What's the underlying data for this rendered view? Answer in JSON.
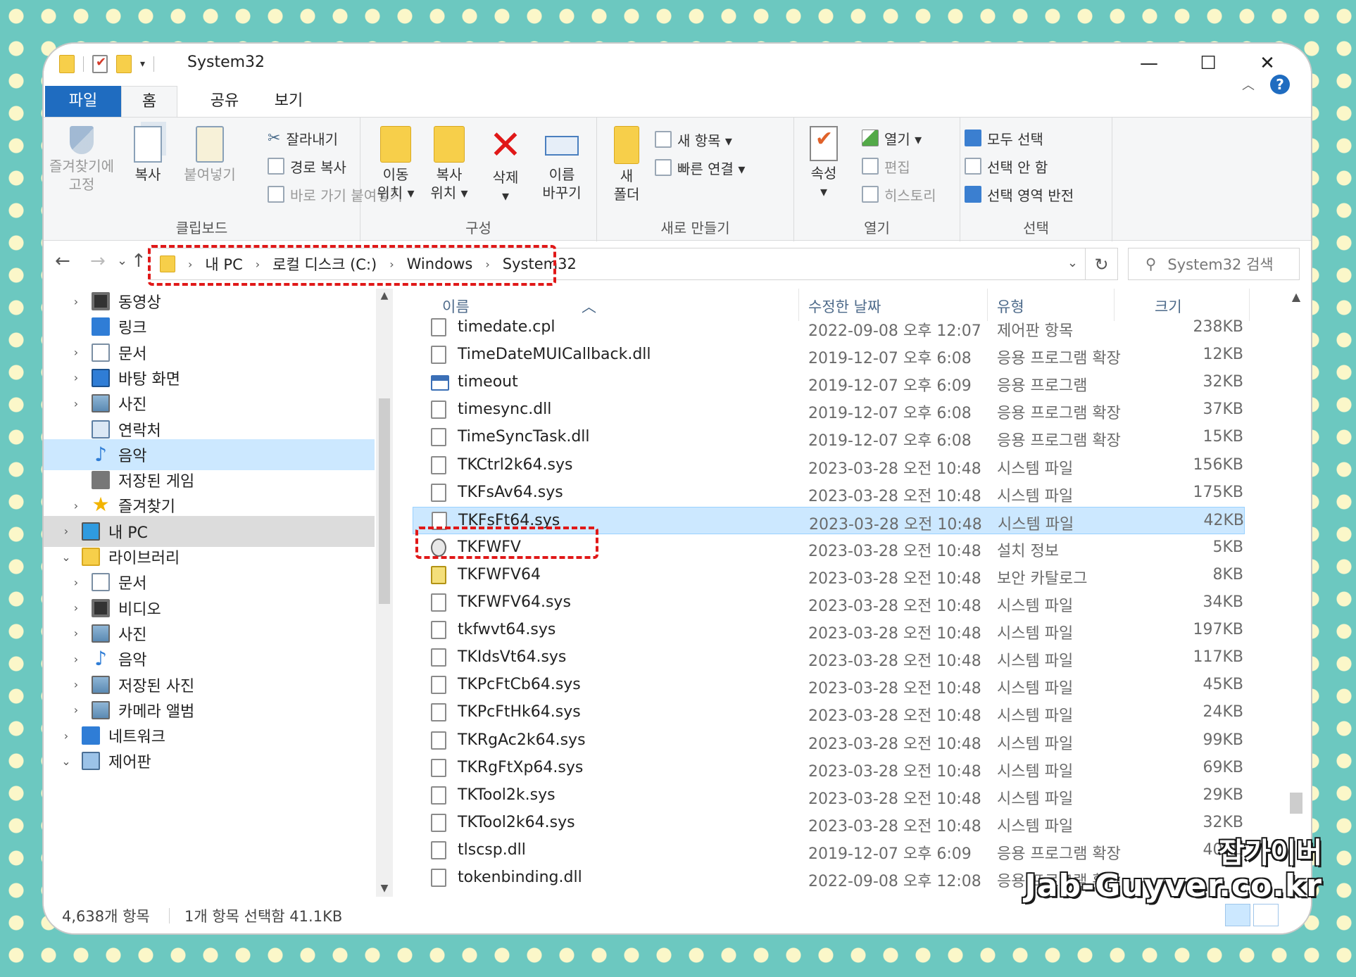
{
  "window": {
    "title": "System32",
    "controls": {
      "minimize": "—",
      "maximize": "☐",
      "close": "✕"
    }
  },
  "ribbon_tabs": [
    "파일",
    "홈",
    "공유",
    "보기"
  ],
  "ribbon": {
    "clipboard": {
      "label": "클립보드",
      "pin_l1": "즐겨찾기에",
      "pin_l2": "고정",
      "copy": "복사",
      "paste": "붙여넣기",
      "cut": "잘라내기",
      "copy_path": "경로 복사",
      "paste_shortcut": "바로 가기 붙여넣기"
    },
    "organize": {
      "label": "구성",
      "move_l1": "이동",
      "move_l2": "위치 ▾",
      "copyto_l1": "복사",
      "copyto_l2": "위치 ▾",
      "delete": "삭제",
      "delete_drop": "▾",
      "rename_l1": "이름",
      "rename_l2": "바꾸기"
    },
    "new": {
      "label": "새로 만들기",
      "new_folder_l1": "새",
      "new_folder_l2": "폴더",
      "new_item": "새 항목 ▾",
      "easy_access": "빠른 연결 ▾"
    },
    "open": {
      "label": "열기",
      "properties": "속성",
      "properties_drop": "▾",
      "open": "열기 ▾",
      "edit": "편집",
      "history": "히스토리"
    },
    "select": {
      "label": "선택",
      "select_all": "모두 선택",
      "select_none": "선택 안 함",
      "invert": "선택 영역 반전"
    }
  },
  "nav": {
    "back": "←",
    "forward": "→",
    "recent": "⌄",
    "up": "↑",
    "breadcrumb": [
      "내 PC",
      "로컬 디스크 (C:)",
      "Windows",
      "System32"
    ],
    "refresh": "↻",
    "search_placeholder": "System32 검색"
  },
  "tree": [
    {
      "label": "동영상",
      "icon": "video-icon",
      "chev": "›"
    },
    {
      "label": "링크",
      "icon": "link-icon",
      "chev": ""
    },
    {
      "label": "문서",
      "icon": "document-icon",
      "chev": "›"
    },
    {
      "label": "바탕 화면",
      "icon": "desktop-icon",
      "chev": "›"
    },
    {
      "label": "사진",
      "icon": "picture-icon",
      "chev": "›"
    },
    {
      "label": "연락처",
      "icon": "contact-icon",
      "chev": ""
    },
    {
      "label": "음악",
      "icon": "music-icon",
      "chev": ""
    },
    {
      "label": "저장된 게임",
      "icon": "game-icon",
      "chev": ""
    },
    {
      "label": "즐겨찾기",
      "icon": "star-icon",
      "chev": "›"
    },
    {
      "label": "내 PC",
      "icon": "pc-icon",
      "chev": "›"
    },
    {
      "label": "라이브러리",
      "icon": "library-icon",
      "chev": "⌄"
    },
    {
      "label": "문서",
      "icon": "document-icon",
      "chev": "›"
    },
    {
      "label": "비디오",
      "icon": "video-icon",
      "chev": "›"
    },
    {
      "label": "사진",
      "icon": "picture-icon",
      "chev": "›"
    },
    {
      "label": "음악",
      "icon": "music-icon",
      "chev": "›"
    },
    {
      "label": "저장된 사진",
      "icon": "picture-icon",
      "chev": "›"
    },
    {
      "label": "카메라 앨범",
      "icon": "picture-icon",
      "chev": "›"
    },
    {
      "label": "네트워크",
      "icon": "network-icon",
      "chev": "›"
    },
    {
      "label": "제어판",
      "icon": "control-panel-icon",
      "chev": "⌄"
    }
  ],
  "columns": {
    "name": "이름",
    "date": "수정한 날짜",
    "type": "유형",
    "size": "크기"
  },
  "files": [
    {
      "name": "timedate.cpl",
      "date": "2022-09-08 오후 12:07",
      "type": "제어판 항목",
      "size": "238KB"
    },
    {
      "name": "TimeDateMUICallback.dll",
      "date": "2019-12-07 오후 6:08",
      "type": "응용 프로그램 확장",
      "size": "12KB"
    },
    {
      "name": "timeout",
      "date": "2019-12-07 오후 6:09",
      "type": "응용 프로그램",
      "size": "32KB"
    },
    {
      "name": "timesync.dll",
      "date": "2019-12-07 오후 6:08",
      "type": "응용 프로그램 확장",
      "size": "37KB"
    },
    {
      "name": "TimeSyncTask.dll",
      "date": "2019-12-07 오후 6:08",
      "type": "응용 프로그램 확장",
      "size": "15KB"
    },
    {
      "name": "TKCtrl2k64.sys",
      "date": "2023-03-28 오전 10:48",
      "type": "시스템 파일",
      "size": "156KB"
    },
    {
      "name": "TKFsAv64.sys",
      "date": "2023-03-28 오전 10:48",
      "type": "시스템 파일",
      "size": "175KB"
    },
    {
      "name": "TKFsFt64.sys",
      "date": "2023-03-28 오전 10:48",
      "type": "시스템 파일",
      "size": "42KB"
    },
    {
      "name": "TKFWFV",
      "date": "2023-03-28 오전 10:48",
      "type": "설치 정보",
      "size": "5KB"
    },
    {
      "name": "TKFWFV64",
      "date": "2023-03-28 오전 10:48",
      "type": "보안 카탈로그",
      "size": "8KB"
    },
    {
      "name": "TKFWFV64.sys",
      "date": "2023-03-28 오전 10:48",
      "type": "시스템 파일",
      "size": "34KB"
    },
    {
      "name": "tkfwvt64.sys",
      "date": "2023-03-28 오전 10:48",
      "type": "시스템 파일",
      "size": "197KB"
    },
    {
      "name": "TKIdsVt64.sys",
      "date": "2023-03-28 오전 10:48",
      "type": "시스템 파일",
      "size": "117KB"
    },
    {
      "name": "TKPcFtCb64.sys",
      "date": "2023-03-28 오전 10:48",
      "type": "시스템 파일",
      "size": "45KB"
    },
    {
      "name": "TKPcFtHk64.sys",
      "date": "2023-03-28 오전 10:48",
      "type": "시스템 파일",
      "size": "24KB"
    },
    {
      "name": "TKRgAc2k64.sys",
      "date": "2023-03-28 오전 10:48",
      "type": "시스템 파일",
      "size": "99KB"
    },
    {
      "name": "TKRgFtXp64.sys",
      "date": "2023-03-28 오전 10:48",
      "type": "시스템 파일",
      "size": "69KB"
    },
    {
      "name": "TKTool2k.sys",
      "date": "2023-03-28 오전 10:48",
      "type": "시스템 파일",
      "size": "29KB"
    },
    {
      "name": "TKTool2k64.sys",
      "date": "2023-03-28 오전 10:48",
      "type": "시스템 파일",
      "size": "32KB"
    },
    {
      "name": "tlscsp.dll",
      "date": "2019-12-07 오후 6:09",
      "type": "응용 프로그램 확장",
      "size": "40KB"
    },
    {
      "name": "tokenbinding.dll",
      "date": "2022-09-08 오후 12:08",
      "type": "응용 프로그램 확장",
      "size": ""
    }
  ],
  "status": {
    "count": "4,638개 항목",
    "selection": "1개 항목 선택함 41.1KB"
  },
  "watermark": {
    "line1": "잡가이버",
    "line2": "Jab-Guyver.co.kr"
  },
  "colors": {
    "accent": "#1f6cc0",
    "selection": "#cce8ff",
    "highlight": "#e01818"
  }
}
